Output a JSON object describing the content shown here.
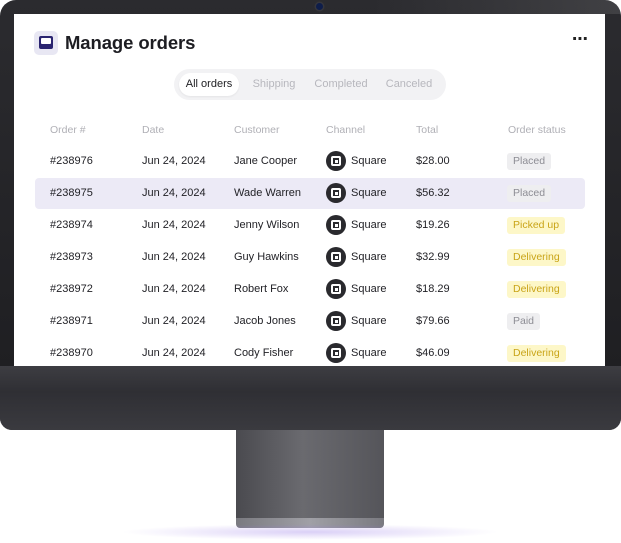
{
  "page": {
    "title": "Manage orders",
    "more_icon": "⋯"
  },
  "icons": {
    "logo": "inbox-logo-icon",
    "more": "more-horizontal-icon",
    "channel": "square-pos-icon"
  },
  "colors": {
    "accent": "#2a2470",
    "selected_row": "#eceaf6",
    "badge_yellow_bg": "#fdf7c8",
    "badge_yellow_text": "#c9a418",
    "badge_grey_bg": "#eeeef0",
    "badge_grey_text": "#8d8d94"
  },
  "tabs": [
    {
      "label": "All orders",
      "active": true
    },
    {
      "label": "Shipping",
      "active": false
    },
    {
      "label": "Completed",
      "active": false
    },
    {
      "label": "Canceled",
      "active": false
    }
  ],
  "table": {
    "headers": [
      "Order #",
      "Date",
      "Customer",
      "Channel",
      "Total",
      "Order status"
    ],
    "rows": [
      {
        "order": "#238976",
        "date": "Jun 24, 2024",
        "customer": "Jane Cooper",
        "channel": "Square",
        "total": "$28.00",
        "status": "Placed",
        "status_style": "grey",
        "selected": false
      },
      {
        "order": "#238975",
        "date": "Jun 24, 2024",
        "customer": "Wade Warren",
        "channel": "Square",
        "total": "$56.32",
        "status": "Placed",
        "status_style": "grey",
        "selected": true
      },
      {
        "order": "#238974",
        "date": "Jun 24, 2024",
        "customer": "Jenny Wilson",
        "channel": "Square",
        "total": "$19.26",
        "status": "Picked up",
        "status_style": "yellow",
        "selected": false
      },
      {
        "order": "#238973",
        "date": "Jun 24, 2024",
        "customer": "Guy Hawkins",
        "channel": "Square",
        "total": "$32.99",
        "status": "Delivering",
        "status_style": "yellow",
        "selected": false
      },
      {
        "order": "#238972",
        "date": "Jun 24, 2024",
        "customer": "Robert Fox",
        "channel": "Square",
        "total": "$18.29",
        "status": "Delivering",
        "status_style": "yellow",
        "selected": false
      },
      {
        "order": "#238971",
        "date": "Jun 24, 2024",
        "customer": "Jacob Jones",
        "channel": "Square",
        "total": "$79.66",
        "status": "Paid",
        "status_style": "grey",
        "selected": false
      },
      {
        "order": "#238970",
        "date": "Jun 24, 2024",
        "customer": "Cody Fisher",
        "channel": "Square",
        "total": "$46.09",
        "status": "Delivering",
        "status_style": "yellow",
        "selected": false
      }
    ]
  }
}
